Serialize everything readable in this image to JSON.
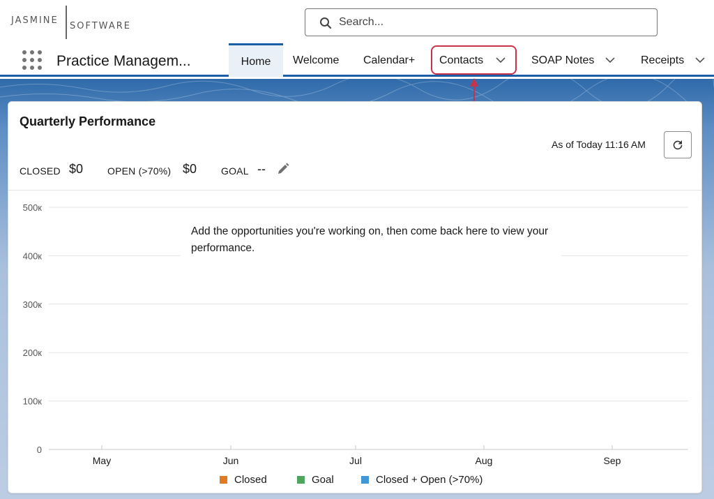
{
  "header": {
    "logo_top": "JASMINE",
    "logo_bottom": "SOFTWARE",
    "search_placeholder": "Search..."
  },
  "nav": {
    "app_name": "Practice Managem...",
    "tabs": [
      {
        "label": "Home",
        "active": true,
        "dropdown": false
      },
      {
        "label": "Welcome",
        "active": false,
        "dropdown": false
      },
      {
        "label": "Calendar+",
        "active": false,
        "dropdown": false
      },
      {
        "label": "Contacts",
        "active": false,
        "dropdown": true,
        "highlighted": true
      },
      {
        "label": "SOAP Notes",
        "active": false,
        "dropdown": true
      },
      {
        "label": "Receipts",
        "active": false,
        "dropdown": true
      }
    ]
  },
  "card": {
    "title": "Quarterly Performance",
    "as_of": "As of Today 11:16 AM",
    "metrics": {
      "closed_label": "CLOSED",
      "closed_value": "$0",
      "open_label": "OPEN (>70%)",
      "open_value": "$0",
      "goal_label": "GOAL",
      "goal_value": "--"
    },
    "empty_message": "Add the opportunities you're working on, then come back here to view your performance."
  },
  "chart_data": {
    "type": "line",
    "x": [
      "May",
      "Jun",
      "Jul",
      "Aug",
      "Sep"
    ],
    "y_ticks": [
      "0",
      "100к",
      "200к",
      "300к",
      "400к",
      "500к"
    ],
    "ylim": [
      0,
      500000
    ],
    "grid": true,
    "series": [
      {
        "name": "Closed",
        "color": "#e07b24",
        "values": []
      },
      {
        "name": "Goal",
        "color": "#4ea55d",
        "values": []
      },
      {
        "name": "Closed + Open (>70%)",
        "color": "#3f97d8",
        "values": []
      }
    ],
    "legend": "bottom"
  },
  "colors": {
    "accent": "#1b5ea8",
    "highlight": "#c7324d"
  }
}
